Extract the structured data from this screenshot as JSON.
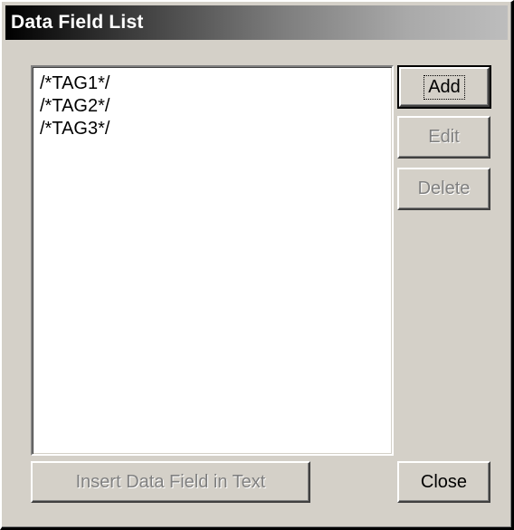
{
  "window": {
    "title": "Data Field List"
  },
  "list": {
    "items": [
      "/*TAG1*/",
      "/*TAG2*/",
      "/*TAG3*/"
    ]
  },
  "buttons": {
    "add": "Add",
    "edit": "Edit",
    "delete": "Delete",
    "insert": "Insert Data Field in Text",
    "close": "Close"
  },
  "state": {
    "default_button": "Add",
    "disabled_buttons": [
      "Edit",
      "Delete",
      "Insert Data Field in Text"
    ]
  }
}
